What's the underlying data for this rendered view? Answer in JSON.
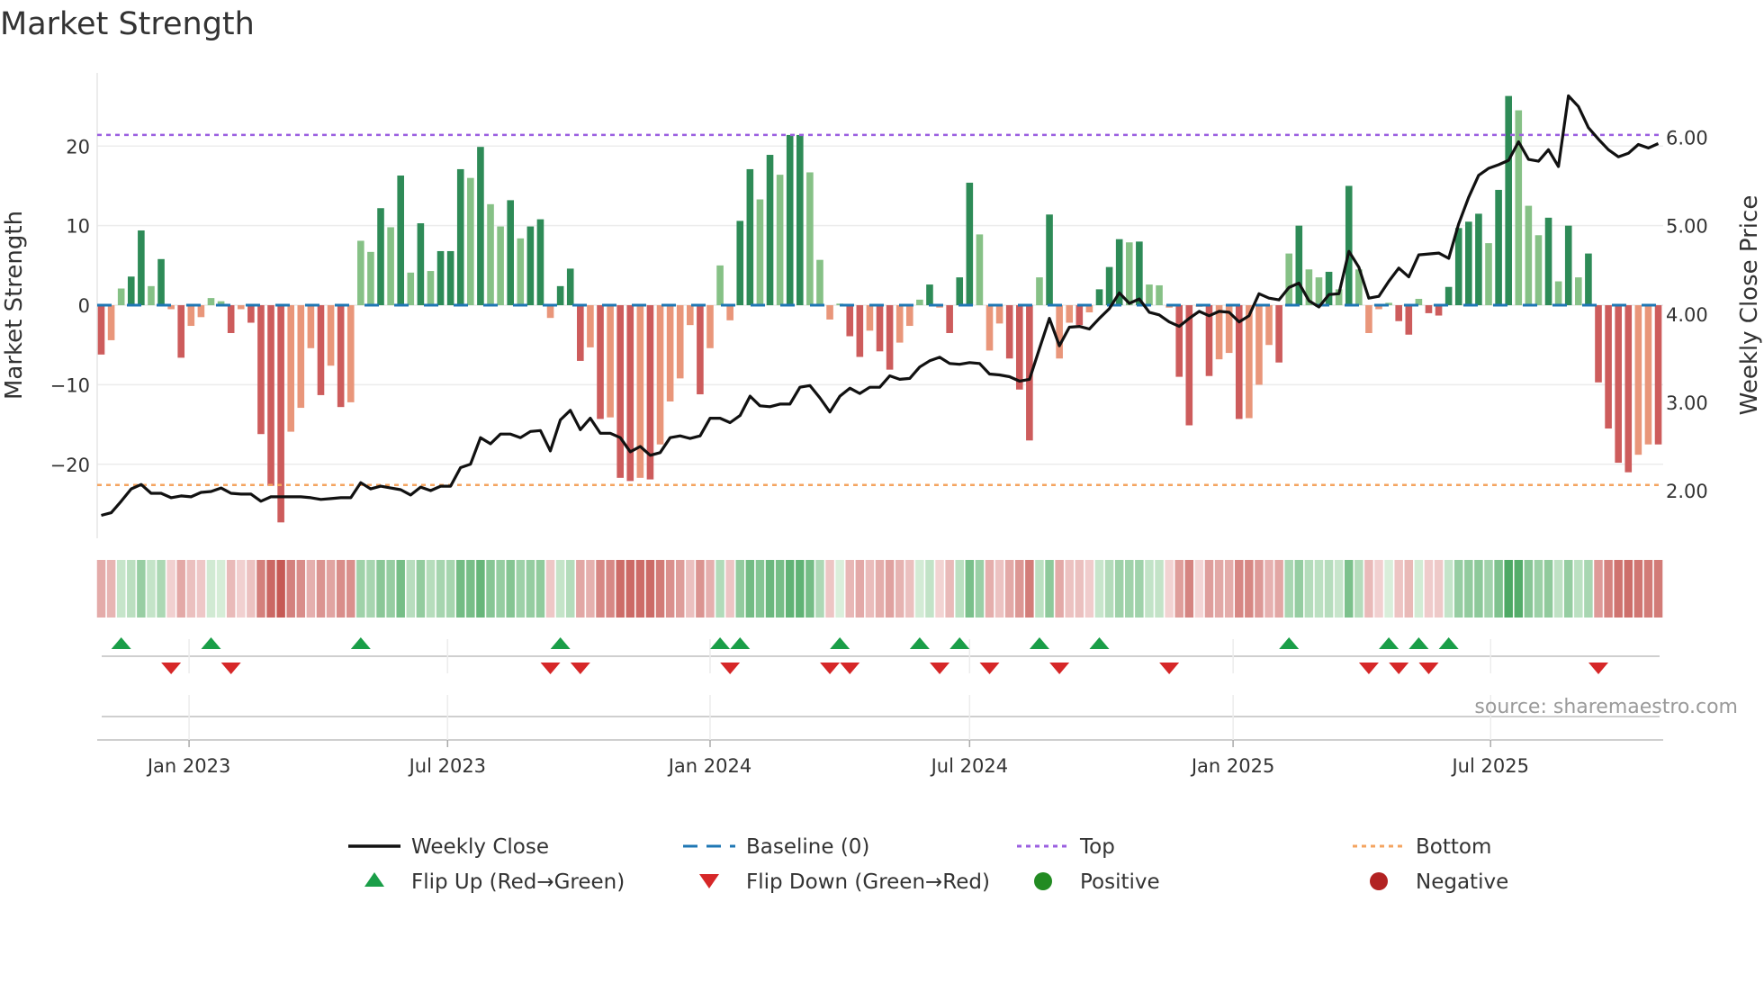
{
  "title": "Market Strength",
  "source_note": "source: sharemaestro.com",
  "colors": {
    "strong_up": "#2e8b57",
    "weak_up": "#86c186",
    "strong_down": "#cd5c5c",
    "weak_down": "#e9967a",
    "close_line": "#111111",
    "baseline": "#1f77b4",
    "top": "#9b5fe0",
    "bottom": "#f4a460",
    "flip_up": "#1a9e48",
    "flip_down": "#d62728",
    "positive": "#228b22",
    "negative": "#b22222"
  },
  "legend": [
    {
      "label": "Weekly Close",
      "icon": "solid-line-icon",
      "color": "#111111"
    },
    {
      "label": "Baseline (0)",
      "icon": "dashed-line-icon",
      "color": "#1f77b4"
    },
    {
      "label": "Top",
      "icon": "dotted-line-icon",
      "color": "#9b5fe0"
    },
    {
      "label": "Bottom",
      "icon": "dotted-line-icon",
      "color": "#f4a460"
    },
    {
      "label": "Flip Up (Red→Green)",
      "icon": "triangle-up-icon",
      "color": "#1a9e48"
    },
    {
      "label": "Flip Down (Green→Red)",
      "icon": "triangle-down-icon",
      "color": "#d62728"
    },
    {
      "label": "Positive",
      "icon": "circle-icon",
      "color": "#228b22"
    },
    {
      "label": "Negative",
      "icon": "circle-icon",
      "color": "#b22222"
    }
  ],
  "chart_data": {
    "type": "bar",
    "title": "Market Strength",
    "ylabel": "Market Strength",
    "y2label": "Weekly Close Price",
    "ylim": [
      -29.3,
      29.2
    ],
    "y2lim": [
      1.46,
      6.73
    ],
    "yticks": [
      20,
      10,
      0,
      -10,
      -20
    ],
    "ytick_labels": [
      "20",
      "10",
      "0",
      "−10",
      "−20"
    ],
    "y2ticks": [
      6,
      5,
      4,
      3,
      2
    ],
    "y2tick_labels": [
      "6.00",
      "5.00",
      "4.00",
      "3.00",
      "2.00"
    ],
    "xtick_labels": [
      "Jan 2023",
      "Jul 2023",
      "Jan 2024",
      "Jul 2024",
      "Jan 2025",
      "Jul 2025"
    ],
    "xtick_week_index": [
      8.8,
      34.7,
      61,
      87,
      113.4,
      139.2
    ],
    "grid": true,
    "legend_position": "bottom",
    "top_line": 21.4,
    "bottom_line": -22.6,
    "baseline": 0,
    "series": [
      {
        "name": "Market Strength",
        "kind": "bar",
        "values": [
          -6.2,
          -4.4,
          2.1,
          3.6,
          9.4,
          2.4,
          5.8,
          -0.5,
          -6.6,
          -2.6,
          -1.5,
          0.9,
          0.5,
          -3.5,
          -0.5,
          -2.2,
          -16.2,
          -22.7,
          -27.3,
          -15.9,
          -12.9,
          -5.4,
          -11.3,
          -7.6,
          -12.8,
          -12.2,
          8.1,
          6.7,
          12.2,
          9.8,
          16.3,
          4.1,
          10.3,
          4.3,
          6.8,
          6.8,
          17.1,
          16,
          19.9,
          12.7,
          9.9,
          13.2,
          8.4,
          9.9,
          10.8,
          -1.6,
          2.4,
          4.6,
          -7,
          -5.3,
          -14.3,
          -14.1,
          -21.7,
          -22.1,
          -21.7,
          -21.9,
          -17.5,
          -12.1,
          -9.2,
          -2.5,
          -11.2,
          -5.4,
          5,
          -1.9,
          10.6,
          17.1,
          13.3,
          18.9,
          16.4,
          21.4,
          21.4,
          16.7,
          5.7,
          -1.8,
          0.2,
          -3.9,
          -6.5,
          -3.2,
          -5.8,
          -8.1,
          -4.7,
          -2.6,
          0.7,
          2.6,
          -0.3,
          -3.5,
          3.5,
          15.4,
          8.9,
          -5.7,
          -2.3,
          -6.7,
          -10.6,
          -17,
          3.5,
          11.4,
          -6.7,
          -2.2,
          -2.5,
          -0.9,
          2,
          4.8,
          8.3,
          7.9,
          8,
          2.6,
          2.5,
          -0.3,
          -9,
          -15.1,
          -0.2,
          -8.9,
          -6.8,
          -6,
          -14.3,
          -14.2,
          -10,
          -5,
          -7.2,
          6.5,
          10,
          4.5,
          3.5,
          4.2,
          2,
          15,
          4.5,
          -3.5,
          -0.5,
          0.3,
          -2,
          -3.7,
          0.8,
          -1,
          -1.3,
          2.3,
          9.7,
          10.5,
          11.5,
          7.8,
          14.5,
          26.3,
          24.5,
          12.5,
          8.8,
          11,
          3,
          10,
          3.5,
          6.5,
          -9.7,
          -15.5,
          -19.8,
          -21,
          -18.8,
          -17.5,
          -17.5
        ]
      },
      {
        "name": "Weekly Close",
        "kind": "line",
        "axis": "right",
        "values": [
          1.72,
          1.75,
          1.88,
          2.02,
          2.07,
          1.97,
          1.97,
          1.92,
          1.94,
          1.93,
          1.98,
          1.99,
          2.03,
          1.97,
          1.96,
          1.96,
          1.88,
          1.93,
          1.93,
          1.93,
          1.93,
          1.92,
          1.9,
          1.91,
          1.92,
          1.92,
          2.09,
          2.02,
          2.05,
          2.03,
          2.01,
          1.95,
          2.04,
          2.0,
          2.05,
          2.05,
          2.26,
          2.3,
          2.6,
          2.53,
          2.64,
          2.64,
          2.6,
          2.67,
          2.68,
          2.45,
          2.8,
          2.91,
          2.69,
          2.82,
          2.65,
          2.65,
          2.6,
          2.44,
          2.5,
          2.4,
          2.43,
          2.6,
          2.62,
          2.59,
          2.62,
          2.82,
          2.82,
          2.77,
          2.85,
          3.07,
          2.96,
          2.95,
          2.98,
          2.98,
          3.17,
          3.19,
          3.05,
          2.89,
          3.07,
          3.16,
          3.1,
          3.17,
          3.17,
          3.3,
          3.26,
          3.27,
          3.4,
          3.47,
          3.51,
          3.44,
          3.43,
          3.45,
          3.44,
          3.32,
          3.31,
          3.29,
          3.24,
          3.26,
          3.61,
          3.95,
          3.64,
          3.85,
          3.86,
          3.83,
          3.95,
          4.06,
          4.24,
          4.12,
          4.17,
          4.02,
          3.99,
          3.91,
          3.86,
          3.95,
          4.03,
          3.98,
          4.03,
          4.02,
          3.91,
          3.98,
          4.23,
          4.18,
          4.16,
          4.3,
          4.35,
          4.15,
          4.08,
          4.22,
          4.23,
          4.71,
          4.53,
          4.18,
          4.2,
          4.37,
          4.52,
          4.42,
          4.67,
          4.68,
          4.69,
          4.63,
          5.02,
          5.32,
          5.57,
          5.65,
          5.69,
          5.74,
          5.95,
          5.75,
          5.73,
          5.86,
          5.67,
          6.47,
          6.35,
          6.11,
          5.98,
          5.86,
          5.78,
          5.82,
          5.92,
          5.88,
          5.93
        ]
      }
    ],
    "flip_up_week_index": [
      2,
      11,
      26,
      46,
      62,
      64,
      74,
      82,
      86,
      94,
      100,
      119,
      129,
      132,
      135
    ],
    "flip_down_week_index": [
      7,
      13,
      45,
      48,
      63,
      73,
      75,
      84,
      89,
      96,
      107,
      127,
      130,
      133,
      150
    ]
  }
}
